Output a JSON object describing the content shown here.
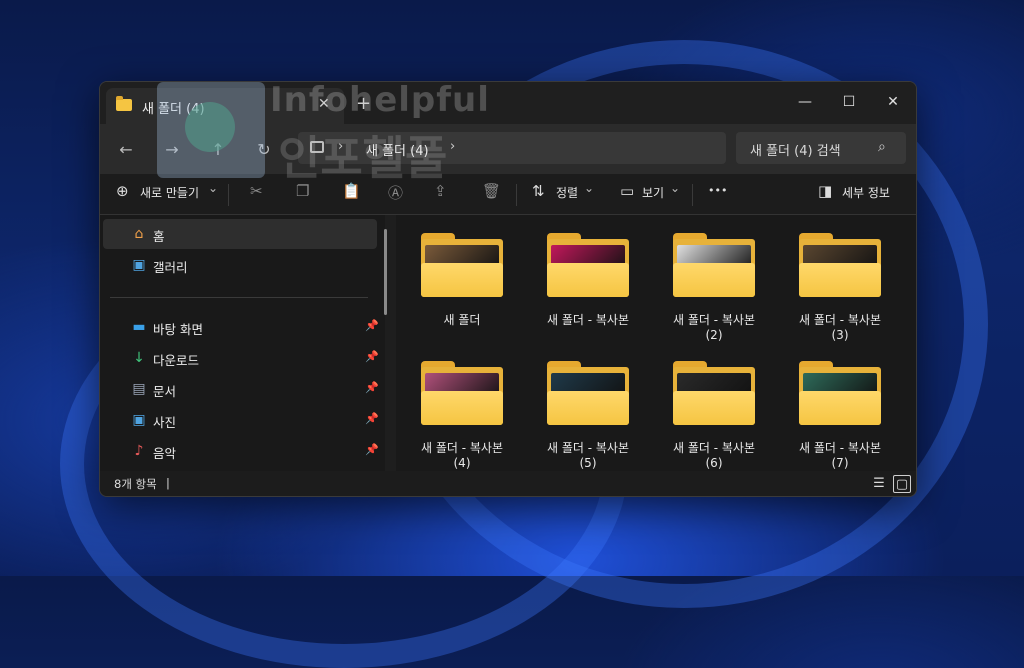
{
  "tab": {
    "title": "새 폴더 (4)",
    "close": "✕",
    "new_tab": "+"
  },
  "window_controls": {
    "minimize": "—",
    "maximize": "☐",
    "close": "✕"
  },
  "nav": {
    "back": "←",
    "forward": "→",
    "up": "↑",
    "refresh": "↻",
    "breadcrumb_sep": "›",
    "breadcrumb": "새 폴더 (4)",
    "search_placeholder": "새 폴더 (4) 검색",
    "search_icon": "⌕"
  },
  "toolbar": {
    "new_label": "새로 만들기",
    "new_icon": "⊕",
    "chevron": "⌄",
    "cut_icon": "✂",
    "copy_icon": "❐",
    "paste_icon": "📋",
    "rename_icon": "Ⓐ",
    "share_icon": "⇪",
    "delete_icon": "🗑",
    "sort_icon": "⇅",
    "sort_label": "정렬",
    "view_icon": "▭",
    "view_label": "보기",
    "more": "•••",
    "details_icon": "◨",
    "details_label": "세부 정보"
  },
  "sidebar": {
    "items": [
      {
        "label": "홈",
        "icon": "home-icon",
        "glyph": "⌂",
        "selected": true,
        "pinned": false
      },
      {
        "label": "갤러리",
        "icon": "gallery-icon",
        "glyph": "▣",
        "selected": false,
        "pinned": false
      },
      {
        "label": "바탕 화면",
        "icon": "desktop-icon",
        "glyph": "▬",
        "selected": false,
        "pinned": true
      },
      {
        "label": "다운로드",
        "icon": "download-icon",
        "glyph": "↓",
        "selected": false,
        "pinned": true
      },
      {
        "label": "문서",
        "icon": "document-icon",
        "glyph": "▤",
        "selected": false,
        "pinned": true
      },
      {
        "label": "사진",
        "icon": "picture-icon",
        "glyph": "▣",
        "selected": false,
        "pinned": true
      },
      {
        "label": "음악",
        "icon": "music-icon",
        "glyph": "♪",
        "selected": false,
        "pinned": true
      }
    ],
    "pin_glyph": "📌"
  },
  "folders": [
    {
      "label1": "새 폴더",
      "label2": "",
      "paper": "#7a5a3a"
    },
    {
      "label1": "새 폴더 - 복사본",
      "label2": "",
      "paper": "#c2185b"
    },
    {
      "label1": "새 폴더 - 복사본",
      "label2": "(2)",
      "paper": "#e0e0e0"
    },
    {
      "label1": "새 폴더 - 복사본",
      "label2": "(3)",
      "paper": "#5a4630"
    },
    {
      "label1": "새 폴더 - 복사본",
      "label2": "(4)",
      "paper": "#b0507a"
    },
    {
      "label1": "새 폴더 - 복사본",
      "label2": "(5)",
      "paper": "#1f3a4a"
    },
    {
      "label1": "새 폴더 - 복사본",
      "label2": "(6)",
      "paper": "#2a2a2a"
    },
    {
      "label1": "새 폴더 - 복사본",
      "label2": "(7)",
      "paper": "#2e6b5a"
    }
  ],
  "status": {
    "count_text": "8개 항목",
    "divider": "|",
    "details_view_icon": "☰",
    "tiles_view_icon": "▢"
  },
  "watermark": {
    "line1": "Infohelpful",
    "line2": "인포헬풀"
  },
  "colors": {
    "folder_front": "#f5c542",
    "folder_back": "#e6a92f",
    "window_bg": "#1e1e1e"
  }
}
